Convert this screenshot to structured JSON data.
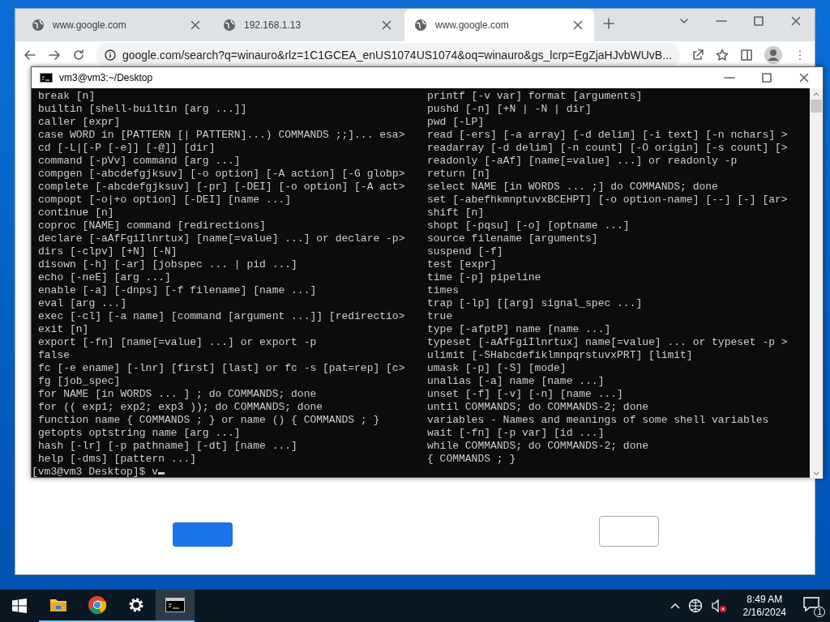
{
  "browser": {
    "tabs": [
      {
        "title": "www.google.com",
        "selected": false
      },
      {
        "title": "192.168.1.13",
        "selected": false
      },
      {
        "title": "www.google.com",
        "selected": true
      }
    ],
    "address": {
      "url": "google.com/search?q=winauro&rlz=1C1GCEA_enUS1074US1074&oq=winauro&gs_lcrp=EgZjaHJvbWUvB..."
    }
  },
  "terminal": {
    "title": "vm3@vm3:~/Desktop",
    "left_lines": [
      "break [n]",
      "builtin [shell-builtin [arg ...]]",
      "caller [expr]",
      "case WORD in [PATTERN [| PATTERN]...) COMMANDS ;;]... esa>",
      "cd [-L|[-P [-e]] [-@]] [dir]",
      "command [-pVv] command [arg ...]",
      "compgen [-abcdefgjksuv] [-o option] [-A action] [-G globp>",
      "complete [-abcdefgjksuv] [-pr] [-DEI] [-o option] [-A act>",
      "compopt [-o|+o option] [-DEI] [name ...]",
      "continue [n]",
      "coproc [NAME] command [redirections]",
      "declare [-aAfFgiIlnrtux] [name[=value] ...] or declare -p>",
      "dirs [-clpv] [+N] [-N]",
      "disown [-h] [-ar] [jobspec ... | pid ...]",
      "echo [-neE] [arg ...]",
      "enable [-a] [-dnps] [-f filename] [name ...]",
      "eval [arg ...]",
      "exec [-cl] [-a name] [command [argument ...]] [redirectio>",
      "exit [n]",
      "export [-fn] [name[=value] ...] or export -p",
      "false",
      "fc [-e ename] [-lnr] [first] [last] or fc -s [pat=rep] [c>",
      "fg [job_spec]",
      "for NAME [in WORDS ... ] ; do COMMANDS; done",
      "for (( exp1; exp2; exp3 )); do COMMANDS; done",
      "function name { COMMANDS ; } or name () { COMMANDS ; }",
      "getopts optstring name [arg ...]",
      "hash [-lr] [-p pathname] [-dt] [name ...]",
      "help [-dms] [pattern ...]"
    ],
    "right_lines": [
      "printf [-v var] format [arguments]",
      "pushd [-n] [+N | -N | dir]",
      "pwd [-LP]",
      "read [-ers] [-a array] [-d delim] [-i text] [-n nchars] >",
      "readarray [-d delim] [-n count] [-O origin] [-s count] [>",
      "readonly [-aAf] [name[=value] ...] or readonly -p",
      "return [n]",
      "select NAME [in WORDS ... ;] do COMMANDS; done",
      "set [-abefhkmnptuvxBCEHPT] [-o option-name] [--] [-] [ar>",
      "shift [n]",
      "shopt [-pqsu] [-o] [optname ...]",
      "source filename [arguments]",
      "suspend [-f]",
      "test [expr]",
      "time [-p] pipeline",
      "times",
      "trap [-lp] [[arg] signal_spec ...]",
      "true",
      "type [-afptP] name [name ...]",
      "typeset [-aAfFgiIlnrtux] name[=value] ... or typeset -p >",
      "ulimit [-SHabcdefiklmnpqrstuvxPRT] [limit]",
      "umask [-p] [-S] [mode]",
      "unalias [-a] name [name ...]",
      "unset [-f] [-v] [-n] [name ...]",
      "until COMMANDS; do COMMANDS-2; done",
      "variables - Names and meanings of some shell variables",
      "wait [-fn] [-p var] [id ...]",
      "while COMMANDS; do COMMANDS-2; done",
      "{ COMMANDS ; }"
    ],
    "prompt": "[vm3@vm3 Desktop]$ v"
  },
  "taskbar": {
    "apps": [
      {
        "kind": "folder",
        "selected": false
      },
      {
        "kind": "browser",
        "selected": false
      },
      {
        "kind": "settings",
        "selected": false
      },
      {
        "kind": "terminal",
        "selected": true
      }
    ],
    "time": "8:49 AM",
    "date": "2/16/2024",
    "notification_count": "1"
  }
}
